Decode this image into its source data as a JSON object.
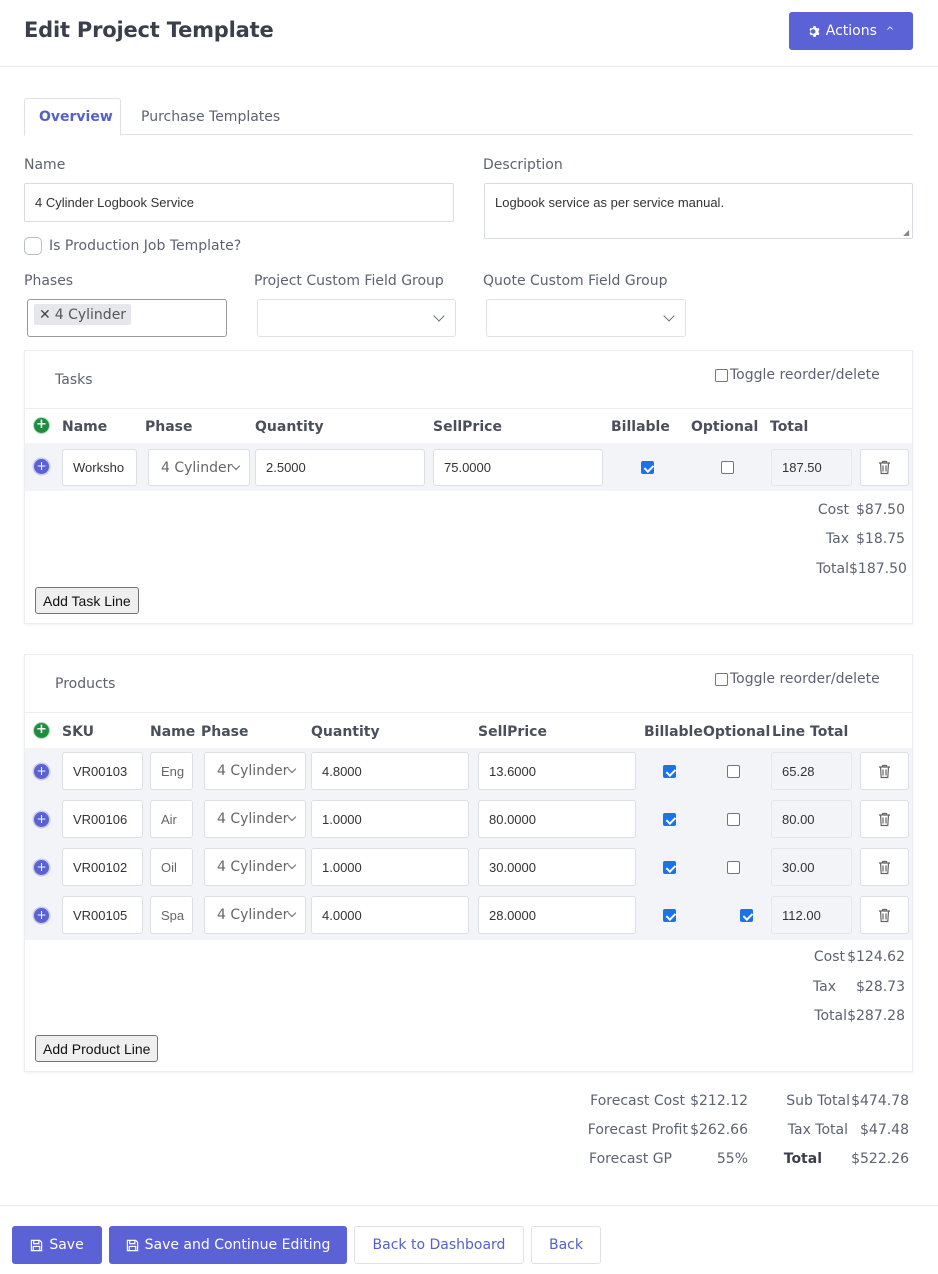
{
  "header": {
    "title": "Edit Project Template",
    "actions_label": "Actions"
  },
  "tabs": [
    {
      "label": "Overview"
    },
    {
      "label": "Purchase Templates"
    }
  ],
  "form": {
    "name_label": "Name",
    "name_value": "4 Cylinder Logbook Service",
    "description_label": "Description",
    "description_value": "Logbook service as per service manual.",
    "production_label": "Is Production Job Template?",
    "phases_label": "Phases",
    "phases_tag": "4 Cylinder",
    "project_cfg_label": "Project Custom Field Group",
    "quote_cfg_label": "Quote Custom Field Group"
  },
  "tasks": {
    "title": "Tasks",
    "toggle_label": "Toggle reorder/delete",
    "headers": {
      "name": "Name",
      "phase": "Phase",
      "quantity": "Quantity",
      "sell_price": "SellPrice",
      "billable": "Billable",
      "optional": "Optional",
      "total": "Total"
    },
    "rows": [
      {
        "name": "Worksho",
        "phase": "4 Cylinder",
        "quantity": "2.5000",
        "sell_price": "75.0000",
        "billable": true,
        "optional": false,
        "total": "187.50"
      }
    ],
    "summary": {
      "cost_label": "Cost",
      "cost": "$87.50",
      "tax_label": "Tax",
      "tax": "$18.75",
      "total_label": "Total",
      "total": "$187.50"
    },
    "add_label": "Add Task Line"
  },
  "products": {
    "title": "Products",
    "toggle_label": "Toggle reorder/delete",
    "headers": {
      "sku": "SKU",
      "name": "Name",
      "phase": "Phase",
      "quantity": "Quantity",
      "sell_price": "SellPrice",
      "billable": "Billable",
      "optional": "Optional",
      "line_total": "Line Total"
    },
    "rows": [
      {
        "sku": "VR00103",
        "name": "Eng",
        "phase": "4 Cylinder",
        "quantity": "4.8000",
        "sell_price": "13.6000",
        "billable": true,
        "optional": false,
        "total": "65.28"
      },
      {
        "sku": "VR00106",
        "name": "Air",
        "phase": "4 Cylinder",
        "quantity": "1.0000",
        "sell_price": "80.0000",
        "billable": true,
        "optional": false,
        "total": "80.00"
      },
      {
        "sku": "VR00102",
        "name": "Oil",
        "phase": "4 Cylinder",
        "quantity": "1.0000",
        "sell_price": "30.0000",
        "billable": true,
        "optional": false,
        "total": "30.00"
      },
      {
        "sku": "VR00105",
        "name": "Spa",
        "phase": "4 Cylinder",
        "quantity": "4.0000",
        "sell_price": "28.0000",
        "billable": true,
        "optional": true,
        "total": "112.00"
      }
    ],
    "summary": {
      "cost_label": "Cost",
      "cost": "$124.62",
      "tax_label": "Tax",
      "tax": "$28.73",
      "total_label": "Total",
      "total": "$287.28"
    },
    "add_label": "Add Product Line"
  },
  "totals": {
    "forecast_cost_label": "Forecast Cost",
    "forecast_cost": "$212.12",
    "forecast_profit_label": "Forecast Profit",
    "forecast_profit": "$262.66",
    "forecast_gp_label": "Forecast GP",
    "forecast_gp": "55%",
    "sub_total_label": "Sub Total",
    "sub_total": "$474.78",
    "tax_total_label": "Tax Total",
    "tax_total": "$47.48",
    "total_label": "Total",
    "total": "$522.26"
  },
  "footer": {
    "save": "Save",
    "save_continue": "Save and Continue Editing",
    "back_dashboard": "Back to Dashboard",
    "back": "Back"
  },
  "colors": {
    "primary": "#5a62d6",
    "add_green": "#1e8e3e",
    "checkbox_blue": "#1a73e8"
  }
}
